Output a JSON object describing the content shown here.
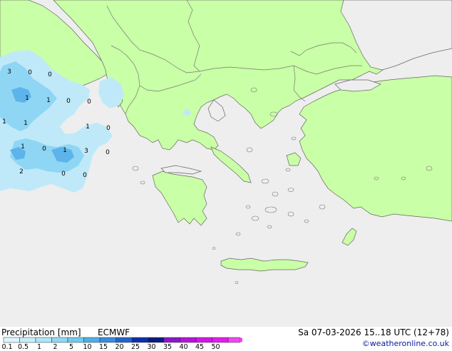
{
  "colors": {
    "sea": "#eeeeee",
    "land": "#c9ffa6",
    "border": "#777777",
    "coast": "#666666",
    "precip_light": "#bfe9f9",
    "precip_medium": "#8fd6f5",
    "precip_heavy": "#5cb4ea"
  },
  "map": {
    "precip_labels": [
      {
        "text": "3"
      },
      {
        "text": "0"
      },
      {
        "text": "0"
      },
      {
        "text": "1"
      },
      {
        "text": "1"
      },
      {
        "text": "0"
      },
      {
        "text": "0"
      },
      {
        "text": "1"
      },
      {
        "text": "1"
      },
      {
        "text": "1"
      },
      {
        "text": "0"
      },
      {
        "text": "1"
      },
      {
        "text": "0"
      },
      {
        "text": "1"
      },
      {
        "text": "3"
      },
      {
        "text": "0"
      },
      {
        "text": "2"
      },
      {
        "text": "0"
      },
      {
        "text": "0"
      }
    ]
  },
  "footer": {
    "title": "Precipitation [mm]",
    "model": "ECMWF",
    "datetime": "Sa 07-03-2026 15..18 UTC (12+78)",
    "credit": "©weatheronline.co.uk"
  },
  "legend": {
    "ticks": [
      "0.1",
      "0.5",
      "1",
      "2",
      "5",
      "10",
      "15",
      "20",
      "25",
      "30",
      "35",
      "40",
      "45",
      "50"
    ],
    "colors": [
      "#dcf6fd",
      "#c7eefb",
      "#aee5f8",
      "#8ed8f3",
      "#6fcaee",
      "#4faee6",
      "#3a8bde",
      "#2464c9",
      "#0d2fa8",
      "#0b1a7e",
      "#8a16c9",
      "#b414d9",
      "#d315e6",
      "#e51aee",
      "#f045f2"
    ]
  }
}
